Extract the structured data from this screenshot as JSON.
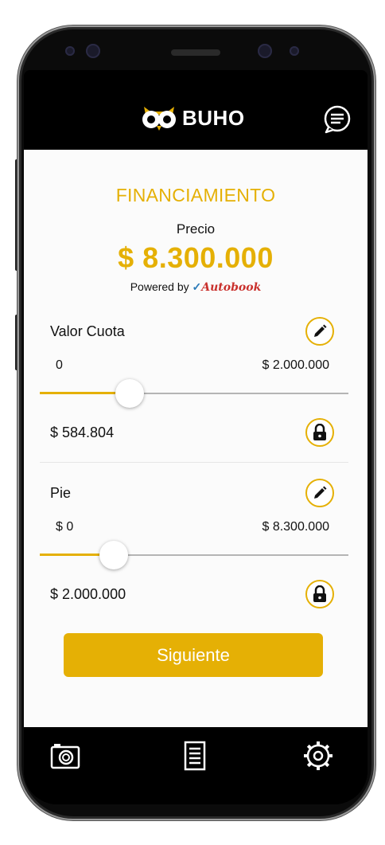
{
  "header": {
    "brand": "BUHO"
  },
  "financing": {
    "title": "FINANCIAMIENTO",
    "price_label": "Precio",
    "price_value": "$ 8.300.000",
    "powered_by": "Powered by",
    "partner": "Autobook"
  },
  "cuota": {
    "label": "Valor Cuota",
    "min": "0",
    "max": "$ 2.000.000",
    "value": "$ 584.804",
    "slider_fraction": 0.29
  },
  "pie": {
    "label": "Pie",
    "min": "$ 0",
    "max": "$ 8.300.000",
    "value": "$ 2.000.000",
    "slider_fraction": 0.24
  },
  "cta": {
    "label": "Siguiente"
  },
  "colors": {
    "accent": "#e5b005",
    "bars": "#000000",
    "background": "#fbfbfb"
  },
  "icons": {
    "chat": "chat-bubble-icon",
    "edit": "pencil-icon",
    "lock": "lock-icon",
    "camera": "camera-icon",
    "list": "list-document-icon",
    "settings": "gear-icon"
  }
}
